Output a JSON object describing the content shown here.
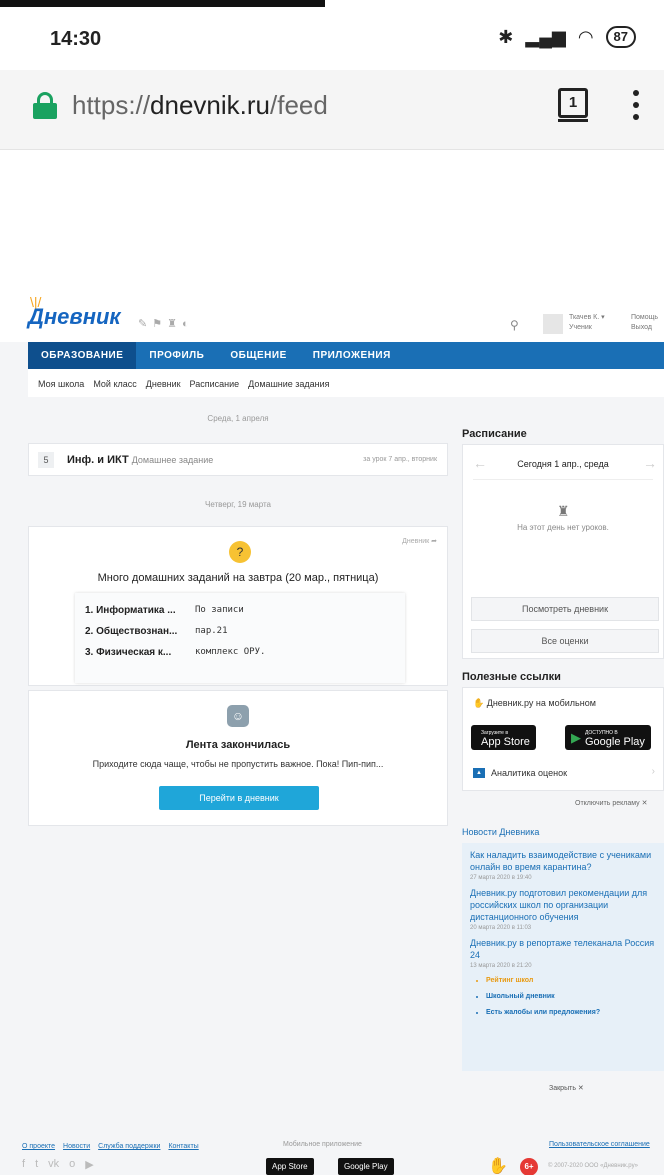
{
  "status_bar": {
    "time": "14:30",
    "battery": "87"
  },
  "browser": {
    "url_prefix": "https://",
    "url_host": "dnevnik.ru",
    "url_path": "/feed",
    "tab_count": "1"
  },
  "site": {
    "logo": "Дневник",
    "user_name": "Ткачев К. ▾",
    "user_role": "Ученик",
    "help": "Помощь",
    "logout": "Выход",
    "main_nav": [
      "ОБРАЗОВАНИЕ",
      "ПРОФИЛЬ",
      "ОБЩЕНИЕ",
      "ПРИЛОЖЕНИЯ"
    ],
    "sub_nav": [
      "Моя школа",
      "Мой класс",
      "Дневник",
      "Расписание",
      "Домашние задания"
    ]
  },
  "feed": {
    "date1": "Среда, 1 апреля",
    "hw_item": {
      "num": "5",
      "subject": "Инф. и ИКТ",
      "label": "Домашнее задание",
      "due": "за урок 7 апр., вторник"
    },
    "date2": "Четверг, 19 марта",
    "card": {
      "source": "Дневник",
      "title": "Много домашних заданий на завтра (20 мар., пятница)",
      "rows": [
        {
          "subject": "1. Информатика ...",
          "task": "По записи"
        },
        {
          "subject": "2. Обществознан...",
          "task": "пар.21"
        },
        {
          "subject": "3. Физическая к...",
          "task": "комплекс ОРУ."
        }
      ]
    },
    "end": {
      "title": "Лента закончилась",
      "text": "Приходите сюда чаще, чтобы не пропустить важное. Пока! Пип-пип...",
      "button": "Перейти в дневник"
    }
  },
  "sidebar": {
    "schedule_title": "Расписание",
    "schedule_day": "Сегодня 1 апр., среда",
    "no_lessons": "На этот день нет уроков.",
    "view_diary": "Посмотреть дневник",
    "all_grades": "Все оценки",
    "links_title": "Полезные ссылки",
    "mobile_link": "Дневник.ру на мобильном",
    "appstore_small": "Загрузите в",
    "appstore_big": "App Store",
    "googleplay_small": "ДОСТУПНО В",
    "googleplay_big": "Google Play",
    "analytics": "Аналитика оценок",
    "ads_off": "Отключить рекламу ✕",
    "news_title": "Новости Дневника",
    "news": [
      {
        "title": "Как наладить взаимодействие с учениками онлайн во время карантина?",
        "date": "27 марта 2020 в 19:40"
      },
      {
        "title": "Дневник.ру подготовил рекомендации для российских школ по организации дистанционного обучения",
        "date": "20 марта 2020 в 11:03"
      },
      {
        "title": "Дневник.ру в репортаже телеканала Россия 24",
        "date": "13 марта 2020 в 21:20"
      }
    ],
    "news_links": [
      "Рейтинг школ",
      "Школьный дневник",
      "Есть жалобы или предложения?"
    ],
    "close": "Закрыть ✕"
  },
  "footer": {
    "links": [
      "О проекте",
      "Новости",
      "Служба поддержки",
      "Контакты"
    ],
    "mobile_app": "Мобильное приложение",
    "appstore": "App Store",
    "googleplay": "Google Play",
    "agreement": "Пользовательское соглашение",
    "age": "6+",
    "copyright": "© 2007-2020 ООО «Дневник.ру»"
  }
}
